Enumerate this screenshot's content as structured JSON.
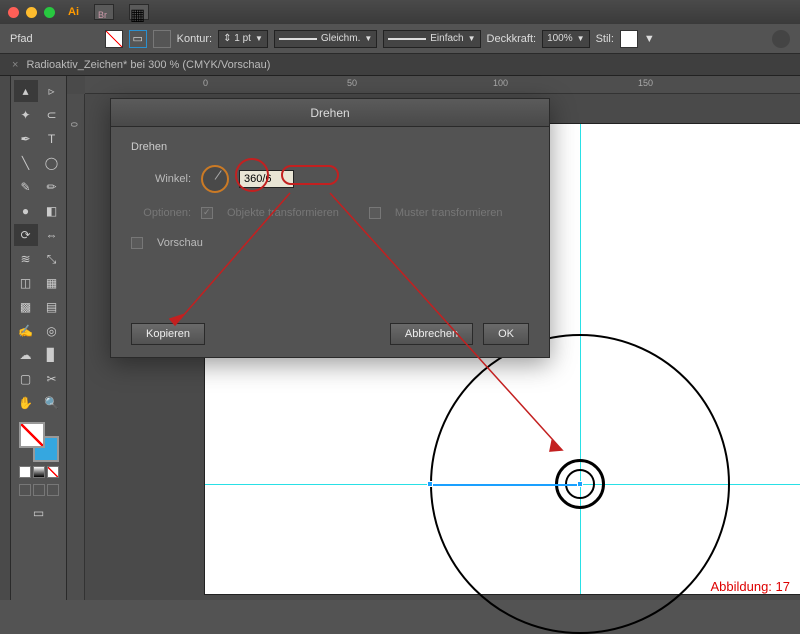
{
  "titlebar": {
    "app": "Ai",
    "bridge": "Br"
  },
  "controlbar": {
    "path_label": "Pfad",
    "stroke_label": "Kontur:",
    "stroke_value": "1 pt",
    "cap_label": "Gleichm.",
    "profile_label": "Einfach",
    "opacity_label": "Deckkraft:",
    "opacity_value": "100%",
    "style_label": "Stil:"
  },
  "tab": {
    "title": "Radioaktiv_Zeichen* bei 300 % (CMYK/Vorschau)"
  },
  "ruler": {
    "marks_h": [
      "0",
      "50",
      "100",
      "150"
    ],
    "marks_v": [
      "0"
    ]
  },
  "dialog": {
    "title": "Drehen",
    "section": "Drehen",
    "angle_label": "Winkel:",
    "angle_value": "360/6",
    "options_label": "Optionen:",
    "opt_transform_objects": "Objekte transformieren",
    "opt_transform_patterns": "Muster transformieren",
    "preview_label": "Vorschau",
    "copy_btn": "Kopieren",
    "cancel_btn": "Abbrechen",
    "ok_btn": "OK"
  },
  "caption": "Abbildung: 17",
  "colors": {
    "guide": "#29e0e6",
    "annotation": "#c32020",
    "accent": "#cb7a25"
  }
}
